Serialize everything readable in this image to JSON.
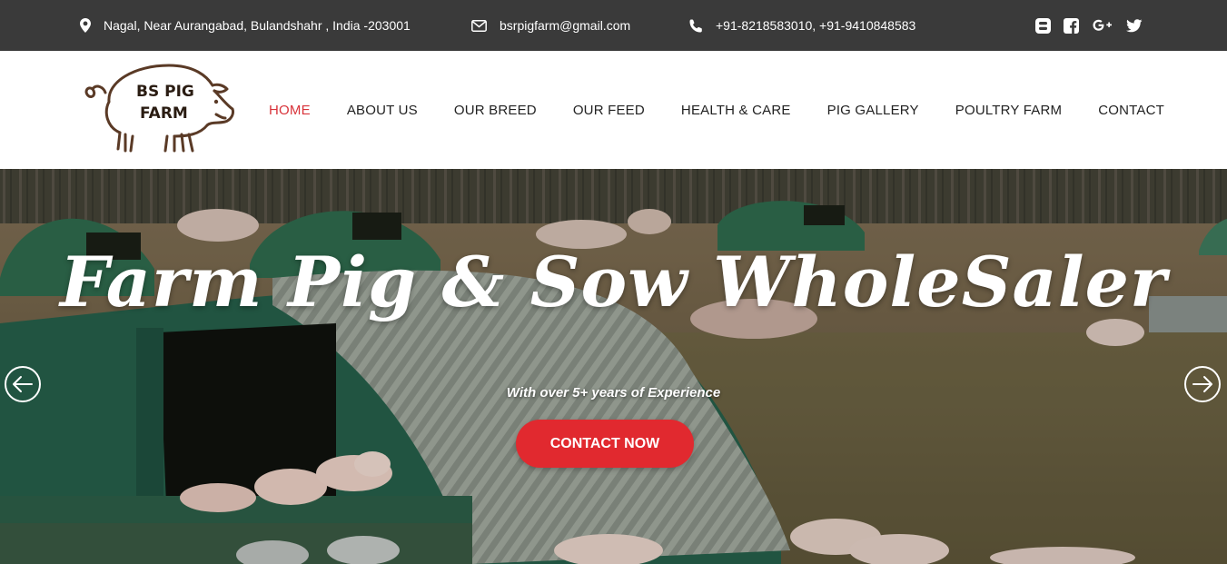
{
  "topbar": {
    "address": "Nagal, Near Aurangabad, Bulandshahr , India -203001",
    "email": "bsrpigfarm@gmail.com",
    "phone": "+91-8218583010, +91-9410848583",
    "icons": {
      "address": "map-marker-icon",
      "email": "envelope-icon",
      "phone": "phone-icon"
    },
    "social": [
      "blogger-icon",
      "facebook-icon",
      "google-plus-icon",
      "twitter-icon"
    ]
  },
  "logo": {
    "line1": "BS PIG",
    "line2": "FARM"
  },
  "nav": {
    "items": [
      {
        "label": "HOME"
      },
      {
        "label": "ABOUT US"
      },
      {
        "label": "OUR BREED"
      },
      {
        "label": "OUR FEED"
      },
      {
        "label": "HEALTH & CARE"
      },
      {
        "label": "PIG GALLERY"
      },
      {
        "label": "POULTRY FARM"
      },
      {
        "label": "CONTACT"
      }
    ],
    "active": "HOME"
  },
  "hero": {
    "title": "Farm Pig & Sow WholeSaler",
    "subtitle": "With over 5+ years of Experience",
    "cta": "CONTACT NOW",
    "prev_icon": "arrow-left-circle-icon",
    "next_icon": "arrow-right-circle-icon"
  },
  "colors": {
    "topbar_bg": "#3a3a3a",
    "accent": "#e1292f",
    "nav_active": "#d8333a",
    "nav_text": "#222222"
  }
}
